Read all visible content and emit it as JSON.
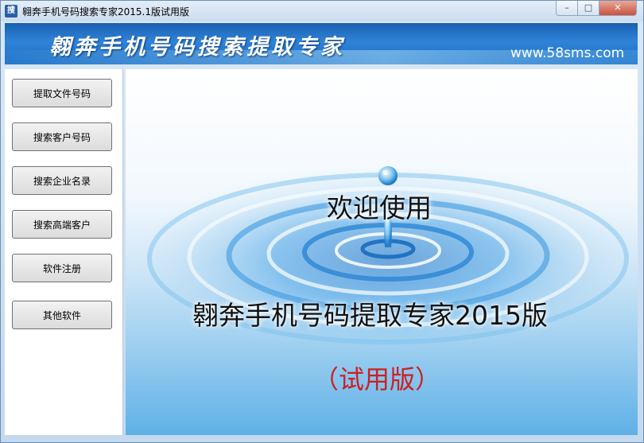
{
  "window": {
    "title": "翱奔手机号码搜索专家2015.1版试用版",
    "app_icon_glyph": "搜",
    "controls": {
      "minimize": "–",
      "maximize": "□",
      "close": "✕"
    }
  },
  "banner": {
    "title": "翱奔手机号码搜索提取专家",
    "url": "www.58sms.com"
  },
  "sidebar": {
    "buttons": [
      {
        "label": "提取文件号码"
      },
      {
        "label": "搜索客户号码"
      },
      {
        "label": "搜索企业名录"
      },
      {
        "label": "搜索高端客户"
      },
      {
        "label": "软件注册"
      },
      {
        "label": "其他软件"
      }
    ]
  },
  "main": {
    "welcome_text": "欢迎使用",
    "product_text": "翱奔手机号码提取专家2015版",
    "trial_text": "（试用版）"
  },
  "colors": {
    "banner": "#1a5fb0",
    "trial_red": "#cc2020",
    "water_blue": "#2f8fd8"
  }
}
